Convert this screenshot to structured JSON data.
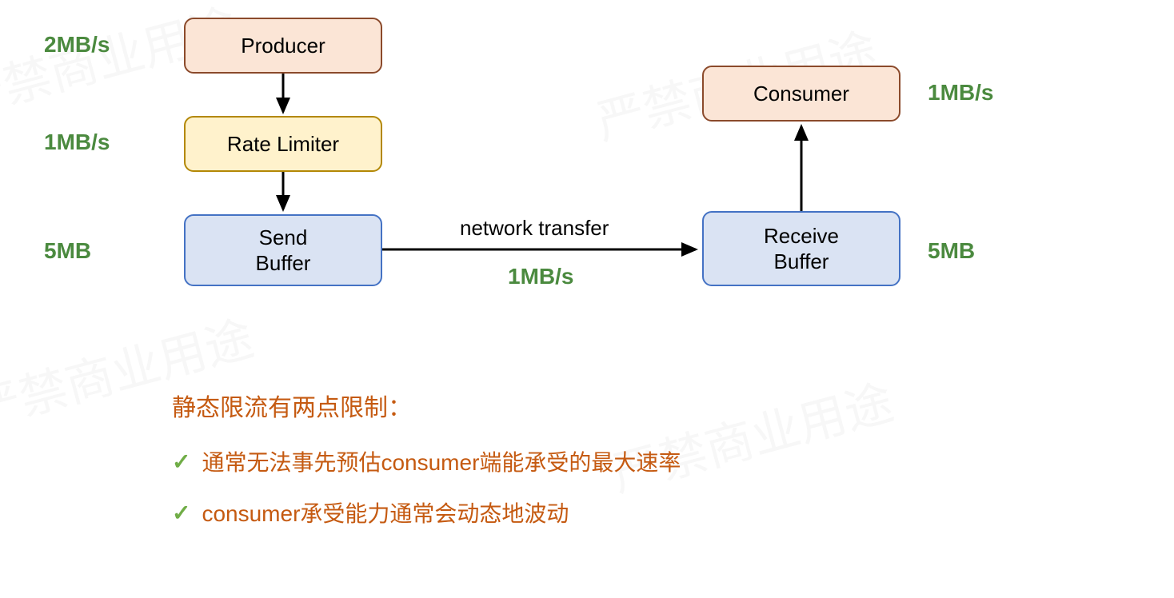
{
  "boxes": {
    "producer": {
      "label": "Producer"
    },
    "rateLimiter": {
      "label": "Rate Limiter"
    },
    "sendBuffer": {
      "label": "Send\nBuffer"
    },
    "receiveBuffer": {
      "label": "Receive\nBuffer"
    },
    "consumer": {
      "label": "Consumer"
    }
  },
  "rates": {
    "producer": "2MB/s",
    "rateLimiter": "1MB/s",
    "sendBuffer": "5MB",
    "consumer": "1MB/s",
    "receiveBuffer": "5MB",
    "networkRate": "1MB/s"
  },
  "edgeLabel": "network transfer",
  "notes": {
    "title": "静态限流有两点限制：",
    "items": [
      "通常无法事先预估consumer端能承受的最大速率",
      "consumer承受能力通常会动态地波动"
    ]
  },
  "watermarkText": "严禁商业用途"
}
